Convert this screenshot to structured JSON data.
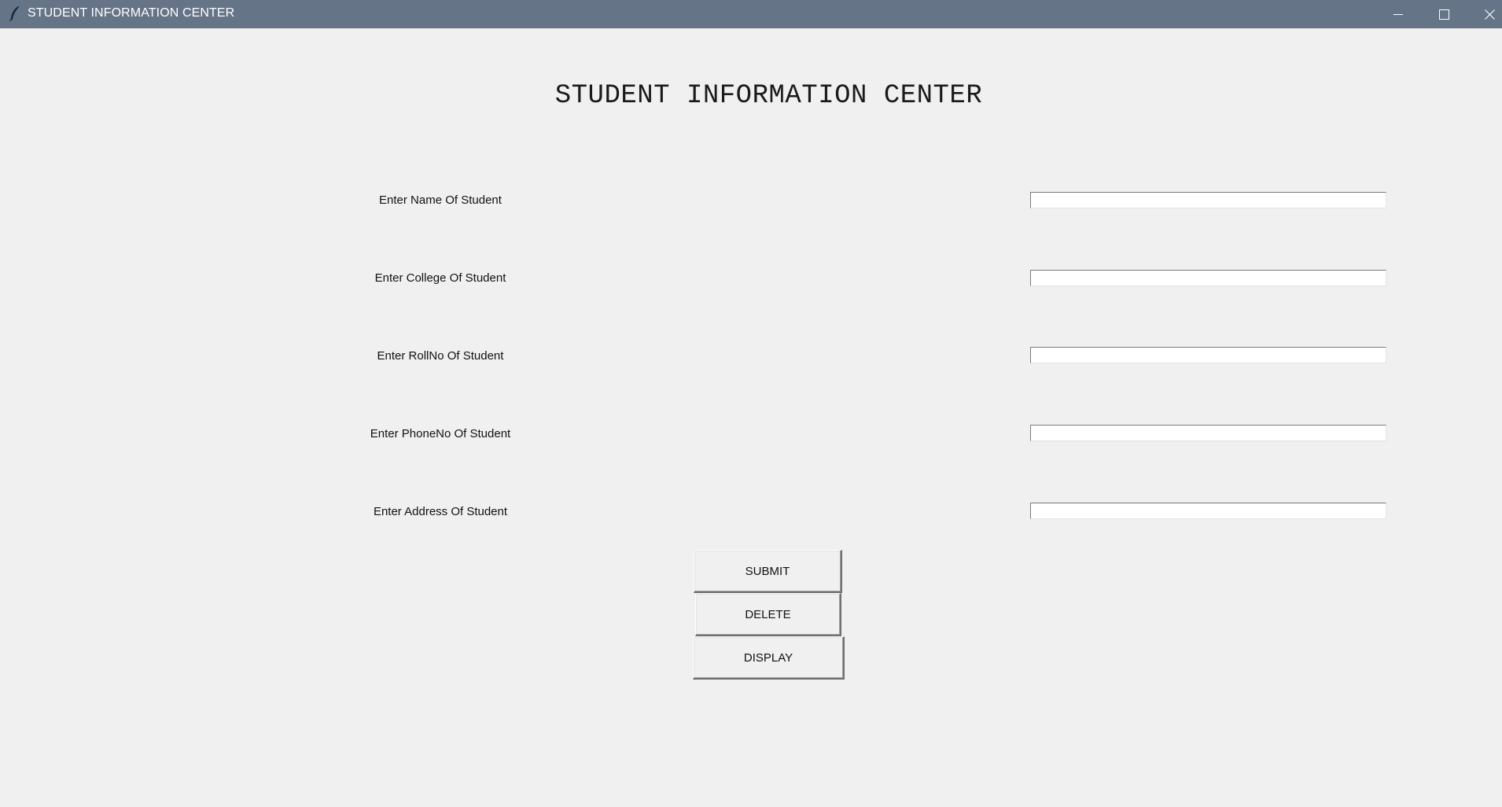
{
  "window": {
    "title": "STUDENT INFORMATION CENTER",
    "app_icon": "feather-icon",
    "controls": {
      "minimize_icon": "minimize-icon",
      "maximize_icon": "maximize-icon",
      "close_icon": "close-icon"
    },
    "titlebar_color": "#667488",
    "background_color": "#f0f0f0"
  },
  "main": {
    "heading": "STUDENT INFORMATION CENTER",
    "fields": [
      {
        "label": "Enter Name Of Student",
        "value": ""
      },
      {
        "label": "Enter College Of Student",
        "value": ""
      },
      {
        "label": "Enter RollNo Of Student",
        "value": ""
      },
      {
        "label": "Enter PhoneNo Of Student",
        "value": ""
      },
      {
        "label": "Enter Address Of Student",
        "value": ""
      }
    ],
    "buttons": {
      "submit": "SUBMIT",
      "delete": "DELETE",
      "display": "DISPLAY"
    }
  }
}
